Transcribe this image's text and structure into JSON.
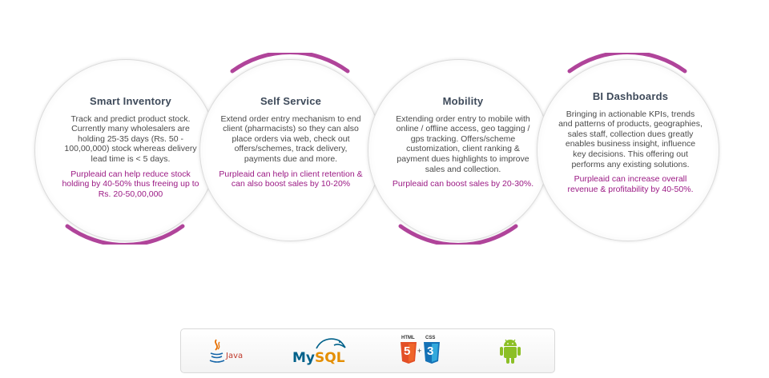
{
  "services": [
    {
      "title": "Smart Inventory",
      "description": "Track and predict product stock. Currently many wholesalers are holding 25-35 days (Rs. 50 - 100,00,000) stock whereas delivery lead time is < 5 days.",
      "highlight": "Purpleaid can help reduce stock holding by 40-50% thus freeing up to Rs. 20-50,00,000"
    },
    {
      "title": "Self Service",
      "description": "Extend order entry mechanism to end client (pharmacists) so they can also place orders via web, check out offers/schemes, track delivery, payments due and more.",
      "highlight": "Purpleaid can help in client retention & can also boost sales by 10-20%"
    },
    {
      "title": "Mobility",
      "description": "Extending order entry to mobile with online / offline access, geo tagging / gps tracking. Offers/scheme customization, client ranking & payment dues highlights to improve sales and collection.",
      "highlight": "Purpleaid can boost sales by 20-30%."
    },
    {
      "title": "BI Dashboards",
      "description": "Bringing in actionable KPIs, trends and patterns of products, geographies, sales staff, collection dues greatly enables business insight, influence key decisions. This offering out performs any existing solutions.",
      "highlight": "Purpleaid can increase overall revenue & profitability by 40-50%."
    }
  ],
  "technologies": {
    "java": "Java",
    "mysql_my": "My",
    "mysql_sql": "SQL",
    "html5": "HTML",
    "html5_num": "5",
    "css3": "CSS",
    "css3_num": "3"
  },
  "colors": {
    "accent_arc": "#b0449a",
    "highlight_text": "#9b1a84",
    "title_text": "#3e4a5a"
  },
  "icons": [
    "java-icon",
    "mysql-icon",
    "html5-icon",
    "css3-icon",
    "android-icon"
  ]
}
